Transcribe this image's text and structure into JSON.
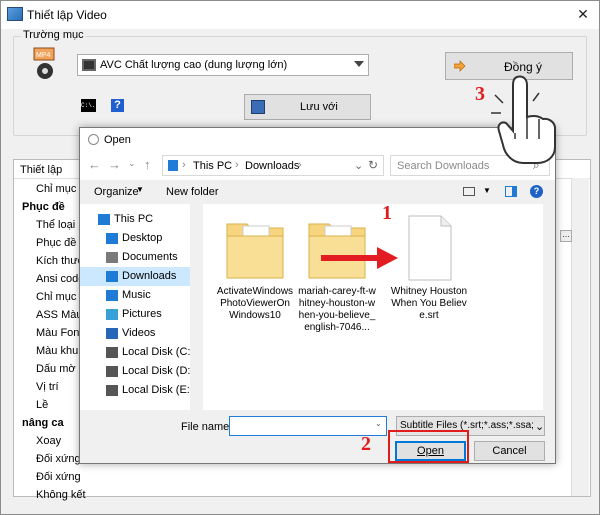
{
  "window": {
    "title": "Thiết lập Video",
    "close": "✕"
  },
  "group": {
    "label": "Trường mục"
  },
  "profile": {
    "value": "AVC Chất lượng cao (dung lượng lớn)"
  },
  "buttons": {
    "ok": "Đồng ý",
    "save_as": "Lưu với"
  },
  "help_glyph": "?",
  "cmd_glyph": "C:\\.",
  "settings": {
    "header": "Thiết lập",
    "rows": [
      {
        "label": "Chỉ mục Đ",
        "bold": false,
        "indent": true
      },
      {
        "label": "Phục đề",
        "bold": true,
        "indent": false
      },
      {
        "label": "Thể loại",
        "bold": false,
        "indent": true
      },
      {
        "label": "Phục đề t",
        "bold": false,
        "indent": true
      },
      {
        "label": "Kích thướ",
        "bold": false,
        "indent": true
      },
      {
        "label": "Ansi code",
        "bold": false,
        "indent": true
      },
      {
        "label": "Chỉ mục",
        "bold": false,
        "indent": true
      },
      {
        "label": "ASS Màu",
        "bold": false,
        "indent": true
      },
      {
        "label": "Màu Font",
        "bold": false,
        "indent": true
      },
      {
        "label": "Màu khun",
        "bold": false,
        "indent": true
      },
      {
        "label": "Dấu mờ (p",
        "bold": false,
        "indent": true
      },
      {
        "label": "Vị trí",
        "bold": false,
        "indent": true
      },
      {
        "label": "Lề",
        "bold": false,
        "indent": true
      },
      {
        "label": "nâng ca",
        "bold": true,
        "indent": false
      },
      {
        "label": "Xoay",
        "bold": false,
        "indent": true
      },
      {
        "label": "Đối xứng",
        "bold": false,
        "indent": true
      },
      {
        "label": "Đối xứng",
        "bold": false,
        "indent": true
      },
      {
        "label": "Không kết",
        "bold": false,
        "indent": true
      }
    ]
  },
  "dialog": {
    "title": "Open",
    "path": [
      "This PC",
      "Downloads"
    ],
    "search_placeholder": "Search Downloads",
    "organize": "Organize",
    "new_folder": "New folder",
    "sidebar": [
      "This PC",
      "Desktop",
      "Documents",
      "Downloads",
      "Music",
      "Pictures",
      "Videos",
      "Local Disk (C:)",
      "Local Disk (D:)",
      "Local Disk (E:)"
    ],
    "files": [
      {
        "name": "ActivateWindows PhotoViewerOn Windows10"
      },
      {
        "name": "mariah-carey-ft-whitney-houston-when-you-believe_english-7046..."
      },
      {
        "name": "Whitney Houston When You Believe.srt"
      }
    ],
    "filename_label": "File name:",
    "filename_value": "",
    "filetype": "Subtitle Files (*.srt;*.ass;*.ssa;*.i",
    "open": "Open",
    "cancel": "Cancel"
  },
  "annotations": {
    "step1": "1",
    "step2": "2",
    "step3": "3"
  },
  "colors": {
    "annotation": "#e01d1d",
    "folder": "#f6d57e",
    "selected": "#cce8ff",
    "accent": "#0078d7"
  }
}
